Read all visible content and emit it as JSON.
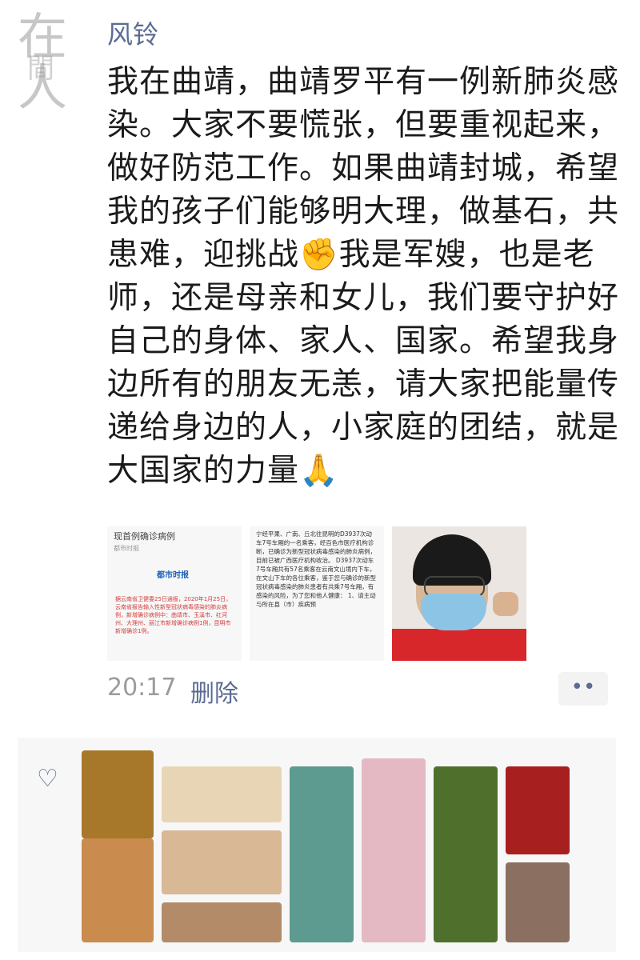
{
  "watermark": {
    "big": "在人",
    "small": "間"
  },
  "post": {
    "username": "风铃",
    "text_before_fist": "我在曲靖，曲靖罗平有一例新肺炎感染。大家不要慌张，但要重视起来，做好防范工作。如果曲靖封城，希望我的孩子们能够明大理，做基石，共患难，迎挑战",
    "fist_emoji": "✊",
    "text_middle": "我是军嫂，也是老师，还是母亲和女儿，我们要守护好自己的身体、家人、国家。希望我身边所有的朋友无恙，请大家把能量传递给身边的人，小家庭的团结，就是大国家的力量",
    "pray_emoji": "🙏",
    "time": "20:17",
    "delete_label": "删除",
    "more_label": "••"
  },
  "images": {
    "doc1": {
      "title": "现首例确诊病例",
      "subtitle": "都市时报",
      "logo": "都市时报",
      "body": "据云南省卫健委25日通报，2020年1月25日，云南省报告输入性新型冠状病毒感染的肺炎病例，新增确诊病例中：曲靖市、玉溪市、红河州、大理州、丽江市新增确诊病例1例，昆明市新增确诊1例。"
    },
    "doc2": {
      "body": "宁经平果、广南、丘北往昆明的D3937次动车7号车厢的一名乘客，经百色市医疗机构诊断，已确诊为新型冠状病毒感染的肺炎病例，目前已被广西医疗机构收治。 D3937次动车7号车厢共有57名乘客在云南文山境内下车，在文山下车的各位乘客，鉴于您与确诊的新型冠状病毒感染的肺炎患者有共乘7号车厢，有感染的风险，为了您和他人健康： 1、请主动与所在县（市）疾病预"
    }
  },
  "likes": {
    "heart_icon": "heart-icon"
  },
  "colors": {
    "link": "#5b6b92",
    "meta": "#9b9b9b",
    "text": "#1b1b1b"
  }
}
